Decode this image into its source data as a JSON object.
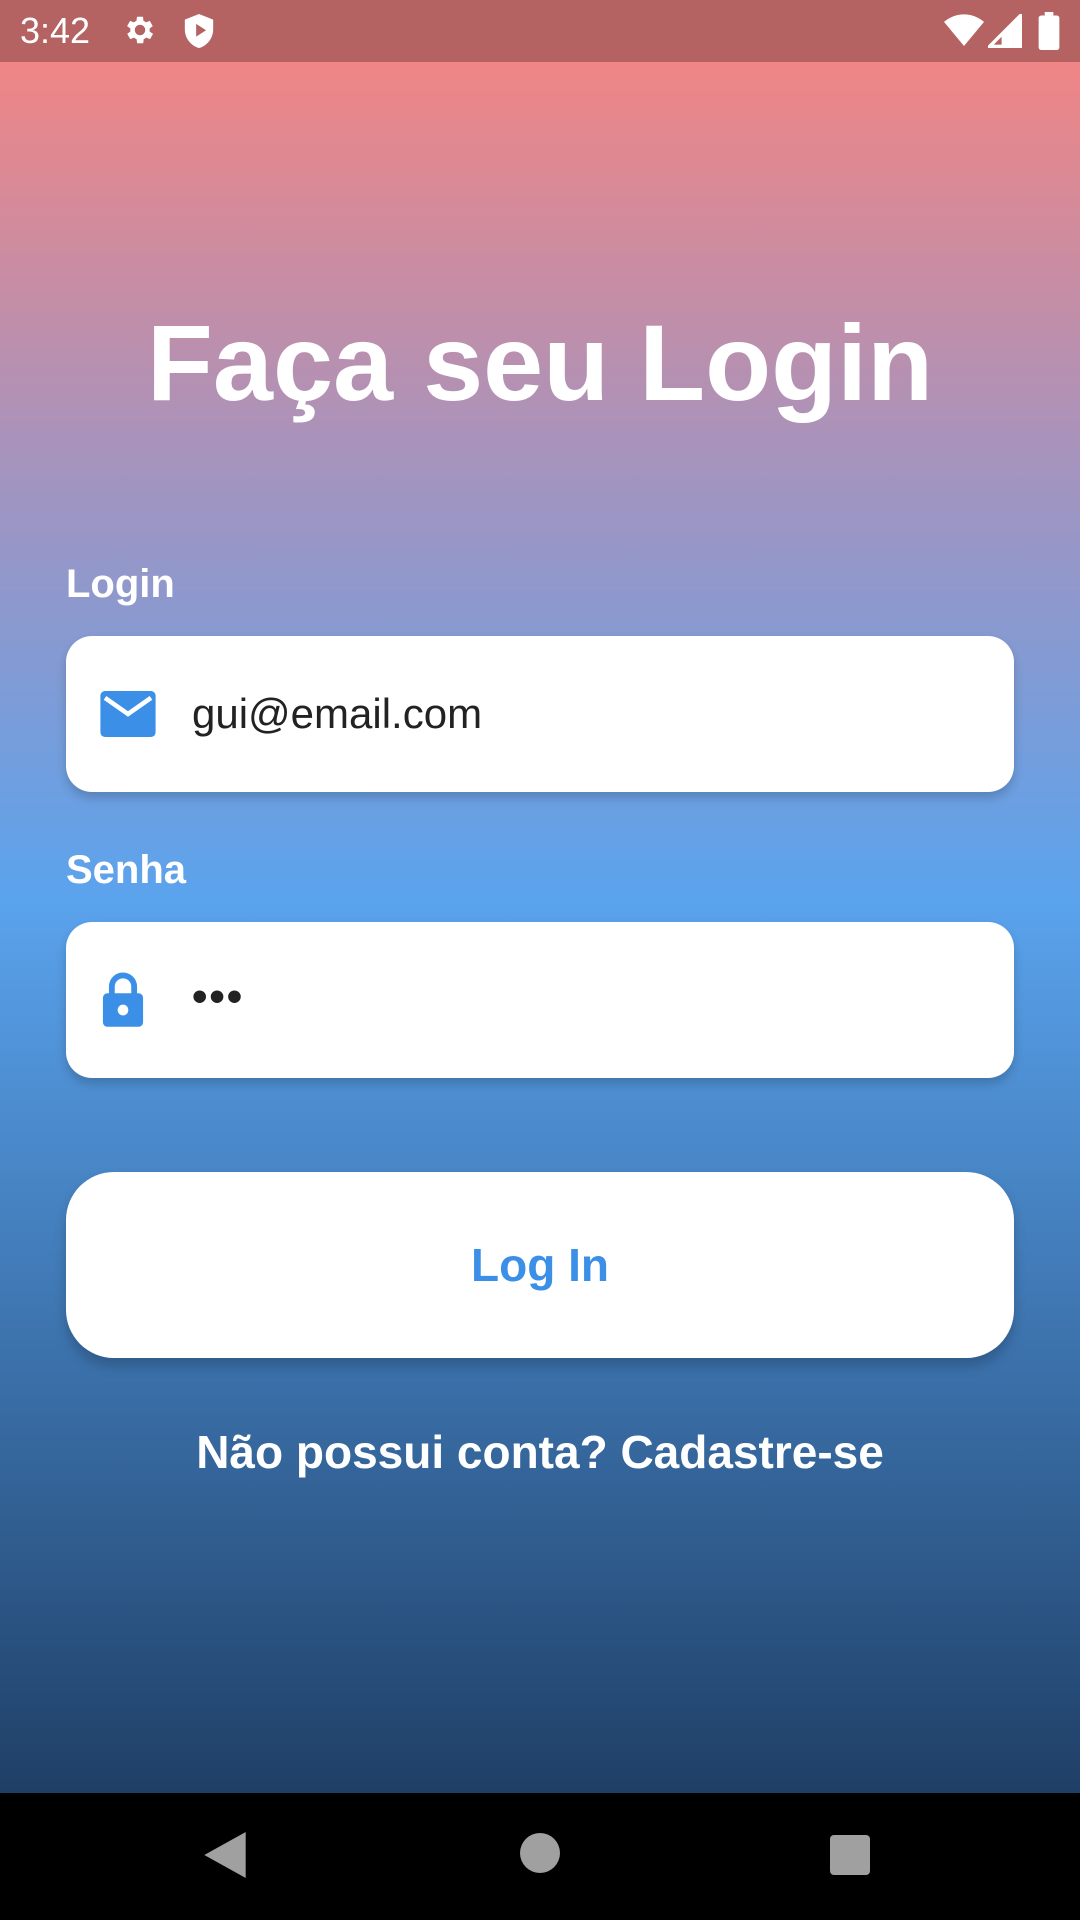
{
  "status_bar": {
    "time": "3:42",
    "icons": [
      "settings-icon",
      "shield-icon",
      "wifi-icon",
      "signal-icon",
      "battery-icon"
    ]
  },
  "page": {
    "title": "Faça seu Login"
  },
  "form": {
    "login_label": "Login",
    "login_value": "gui@email.com",
    "login_icon": "mail-icon",
    "password_label": "Senha",
    "password_value": "•••",
    "password_icon": "lock-icon",
    "submit_label": "Log In"
  },
  "signup": {
    "prompt": "Não possui conta? ",
    "link": "Cadastre-se"
  },
  "nav_bar": {
    "buttons": [
      "back-icon",
      "home-icon",
      "recents-icon"
    ]
  },
  "colors": {
    "accent": "#3b8fe6",
    "status_bar": "#b46262",
    "gradient_top": "#f08585",
    "gradient_mid": "#5aa3ed",
    "gradient_bottom": "#1f3f66"
  }
}
